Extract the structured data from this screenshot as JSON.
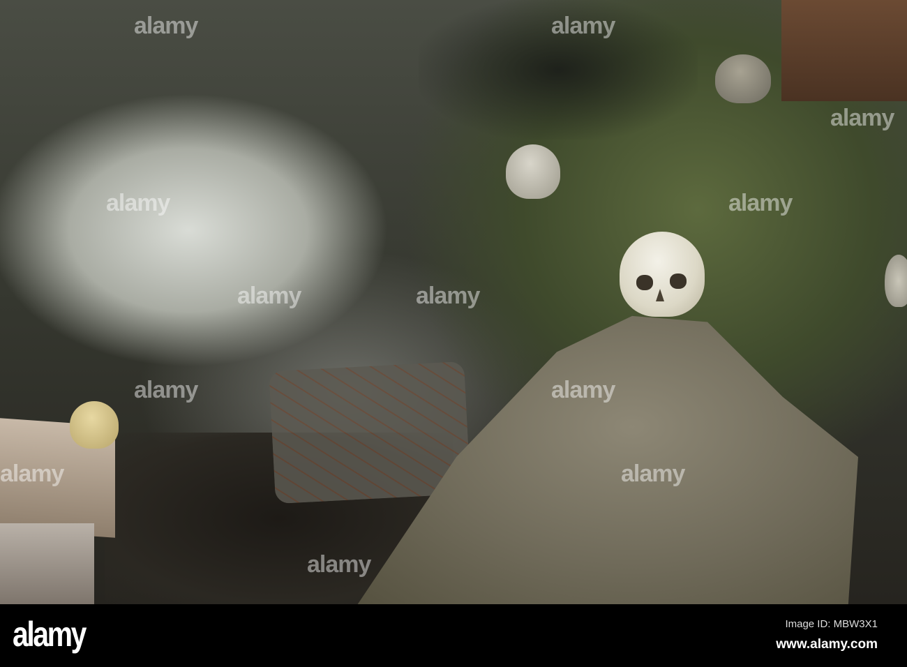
{
  "photo": {
    "subject": "skull-on-rock"
  },
  "watermark": {
    "text": "alamy"
  },
  "footer": {
    "logo": "alamy",
    "image_id": "Image ID: MBW3X1",
    "url": "www.alamy.com"
  }
}
